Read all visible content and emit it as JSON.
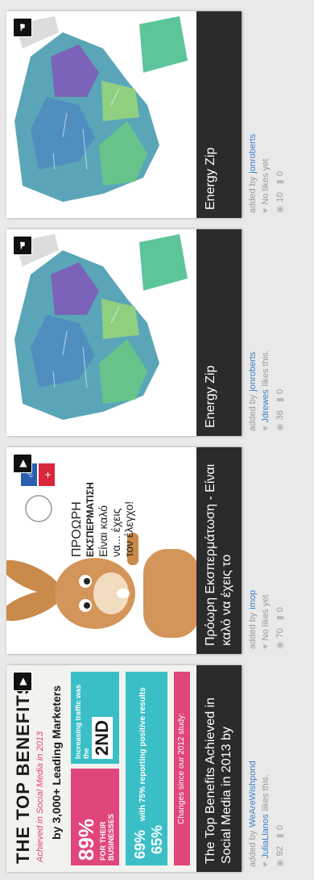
{
  "cards": [
    {
      "caption": "The Top Benefits Achieved in Social Media in 2013 by",
      "added_by_prefix": "added by",
      "added_by": "WeAreWishpond",
      "likes_user": "JuliaLlanos",
      "likes_suffix": "likes this.",
      "views": "92",
      "comments": "0",
      "badge_icon": "play-icon",
      "thumb": {
        "title": "THE TOP BENEFITS",
        "subtitle": "Achieved in Social Media in 2013",
        "by_line": "by 3,000+ Leading Marketers",
        "stat1": "89%",
        "stat1_note": "FOR THEIR BUSINESSES",
        "stat2": "2ND",
        "stat2_note": "Increasing traffic was the",
        "stat3": "with 75% reporting positive results",
        "stat4": "65%",
        "stat5": "69%",
        "footer": "Changes since our 2012 study:"
      }
    },
    {
      "caption": "Πρόωρη Εκσπερμάτωση - Είναι καλό να έχεις το",
      "added_by_prefix": "added by",
      "added_by": "imop",
      "likes_text": "No likes yet",
      "views": "70",
      "comments": "0",
      "badge_icon": "play-icon",
      "thumb": {
        "line1": "ΠΡΟΩΡΗ",
        "line2": "ΕΚΣΠΕΡΜΑΤΙΣΗ",
        "line3": "Είναι καλό",
        "line4": "να... έχεις",
        "line5": "τον έλεγχο!"
      }
    },
    {
      "caption": "Energy Zip",
      "added_by_prefix": "added by",
      "added_by": "jonroberts",
      "likes_user": "Jdrewes",
      "likes_suffix": "likes this.",
      "views": "36",
      "comments": "0",
      "badge_icon": "hand-icon"
    },
    {
      "caption": "Energy Zip",
      "added_by_prefix": "added by",
      "added_by": "jonroberts",
      "likes_text": "No likes yet",
      "views": "10",
      "comments": "0",
      "badge_icon": "hand-icon"
    }
  ],
  "colors": {
    "caption_bg": "#2b2b2b",
    "link": "#3a7fc4",
    "pink": "#e0457b",
    "teal": "#3bbfc6",
    "map_green": "#5cc59a",
    "map_purple": "#7a63b8"
  }
}
